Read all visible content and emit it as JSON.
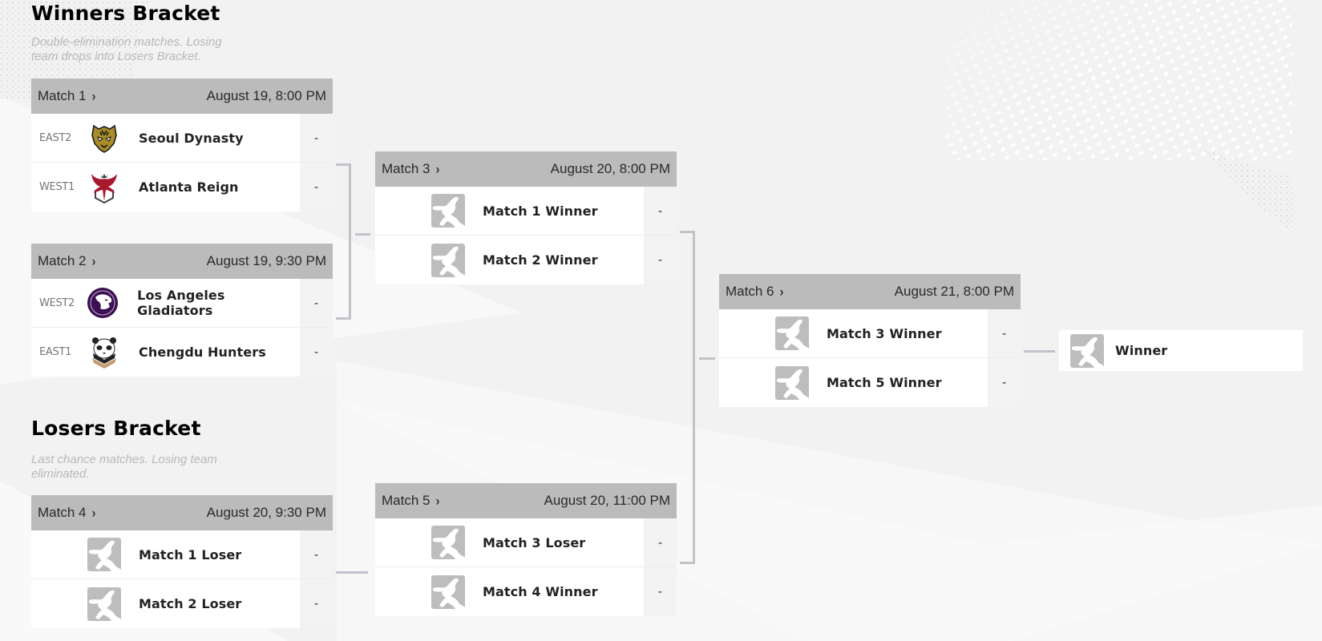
{
  "winners_bracket": {
    "title": "Winners Bracket",
    "description": "Double-elimination matches. Losing team drops into Losers Bracket."
  },
  "losers_bracket": {
    "title": "Losers Bracket",
    "description": "Last chance matches. Losing team eliminated."
  },
  "matches": {
    "m1": {
      "label": "Match 1",
      "date": "August 19, 8:00 PM",
      "teams": [
        {
          "seed": "EAST2",
          "name": "Seoul Dynasty",
          "score": "-",
          "logo": "seoul-dynasty-logo",
          "color": "#a88d2a"
        },
        {
          "seed": "WEST1",
          "name": "Atlanta Reign",
          "score": "-",
          "logo": "atlanta-reign-logo",
          "color": "#a6192e"
        }
      ]
    },
    "m2": {
      "label": "Match 2",
      "date": "August 19, 9:30 PM",
      "teams": [
        {
          "seed": "WEST2",
          "name": "Los Angeles Gladiators",
          "score": "-",
          "logo": "la-gladiators-logo",
          "color": "#3c1053"
        },
        {
          "seed": "EAST1",
          "name": "Chengdu Hunters",
          "score": "-",
          "logo": "chengdu-hunters-logo",
          "color": "#c69b6d"
        }
      ]
    },
    "m3": {
      "label": "Match 3",
      "date": "August 20, 8:00 PM",
      "teams": [
        {
          "seed": "",
          "name": "Match 1 Winner",
          "score": "-",
          "logo": "placeholder-logo"
        },
        {
          "seed": "",
          "name": "Match 2 Winner",
          "score": "-",
          "logo": "placeholder-logo"
        }
      ]
    },
    "m4": {
      "label": "Match 4",
      "date": "August 20, 9:30 PM",
      "teams": [
        {
          "seed": "",
          "name": "Match 1 Loser",
          "score": "-",
          "logo": "placeholder-logo"
        },
        {
          "seed": "",
          "name": "Match 2 Loser",
          "score": "-",
          "logo": "placeholder-logo"
        }
      ]
    },
    "m5": {
      "label": "Match 5",
      "date": "August 20, 11:00 PM",
      "teams": [
        {
          "seed": "",
          "name": "Match 3 Loser",
          "score": "-",
          "logo": "placeholder-logo"
        },
        {
          "seed": "",
          "name": "Match 4 Winner",
          "score": "-",
          "logo": "placeholder-logo"
        }
      ]
    },
    "m6": {
      "label": "Match 6",
      "date": "August 21, 8:00 PM",
      "teams": [
        {
          "seed": "",
          "name": "Match 3 Winner",
          "score": "-",
          "logo": "placeholder-logo"
        },
        {
          "seed": "",
          "name": "Match 5 Winner",
          "score": "-",
          "logo": "placeholder-logo"
        }
      ]
    }
  },
  "final": {
    "label": "Winner",
    "logo": "placeholder-logo"
  },
  "icons": {
    "chevron": "›"
  },
  "colors": {
    "background": "#f2f2f2",
    "header": "#bbbbbb",
    "connector": "#c2c2ca",
    "placeholder": "#bdbdbd"
  }
}
